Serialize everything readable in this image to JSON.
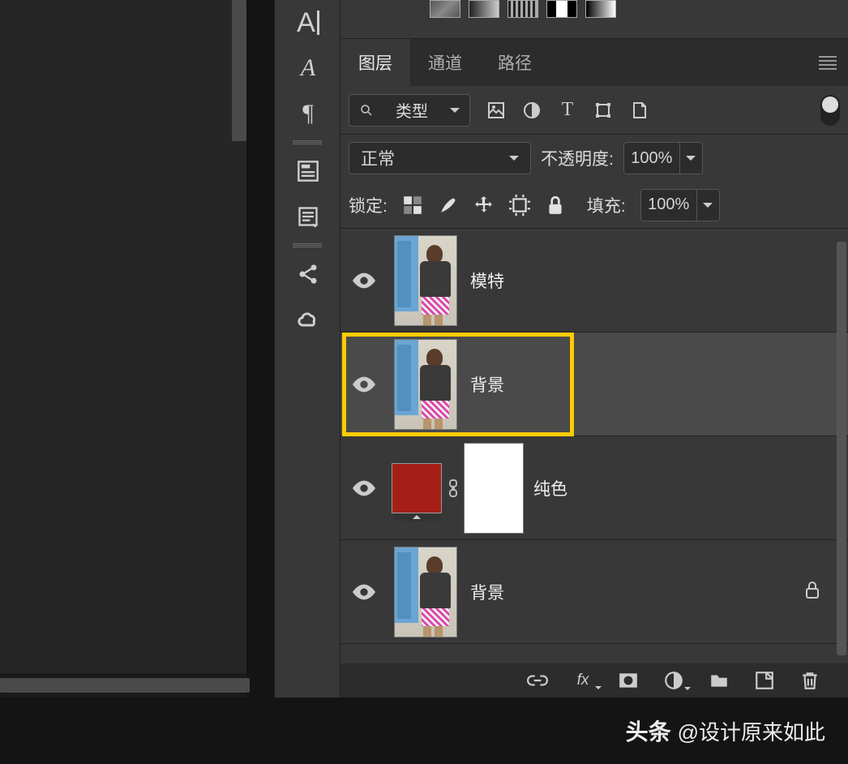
{
  "tabs": {
    "layers": "图层",
    "channels": "通道",
    "paths": "路径"
  },
  "filter": {
    "label": "类型"
  },
  "blend": {
    "mode": "正常",
    "opacity_label": "不透明度:",
    "opacity": "100%"
  },
  "lock": {
    "label": "锁定:",
    "fill_label": "填充:",
    "fill": "100%"
  },
  "layers": [
    {
      "name": "模特"
    },
    {
      "name": "背景"
    },
    {
      "name": "纯色"
    },
    {
      "name": "背景"
    }
  ],
  "watermark": {
    "brand": "头条",
    "at": "@设计原来如此"
  },
  "fx": "fx"
}
